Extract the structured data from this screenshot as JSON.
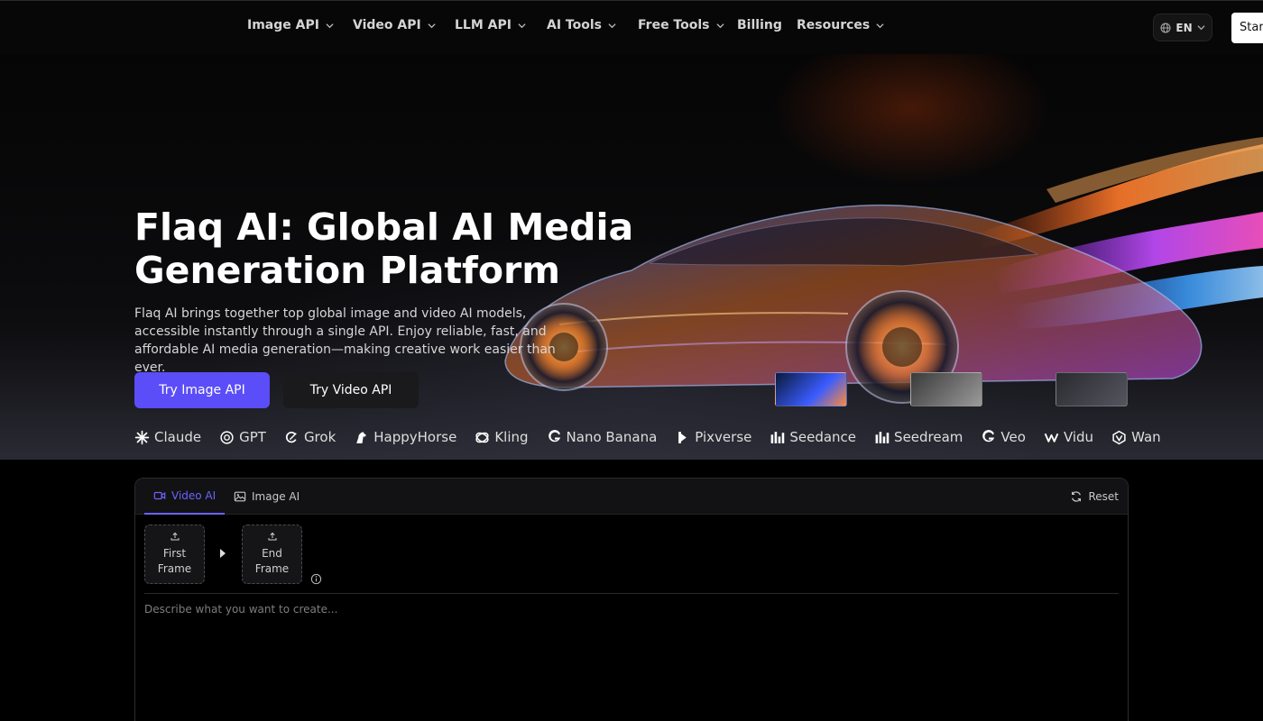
{
  "nav": {
    "items": [
      {
        "label": "Image API",
        "dropdown": true
      },
      {
        "label": "Video API",
        "dropdown": true
      },
      {
        "label": "LLM API",
        "dropdown": true
      },
      {
        "label": "AI Tools",
        "dropdown": true
      },
      {
        "label": "Free Tools",
        "dropdown": true
      },
      {
        "label": "Billing",
        "dropdown": false
      },
      {
        "label": "Resources",
        "dropdown": true
      }
    ],
    "language": "EN",
    "start_label": "Star"
  },
  "hero": {
    "title": "Flaq AI: Global AI Media Generation Platform",
    "description": "Flaq AI brings together top global image and video AI models, accessible instantly through a single API. Enjoy reliable, fast, and affordable AI media generation—making creative work easier than ever.",
    "primary_button": "Try Image API",
    "secondary_button": "Try Video API",
    "models": [
      {
        "name": "Claude",
        "icon": "claude-icon"
      },
      {
        "name": "GPT",
        "icon": "openai-icon"
      },
      {
        "name": "Grok",
        "icon": "grok-icon"
      },
      {
        "name": "HappyHorse",
        "icon": "horse-icon"
      },
      {
        "name": "Kling",
        "icon": "kling-icon"
      },
      {
        "name": "Nano Banana",
        "icon": "google-icon"
      },
      {
        "name": "Pixverse",
        "icon": "pixverse-icon"
      },
      {
        "name": "Seedance",
        "icon": "bars-icon"
      },
      {
        "name": "Seedream",
        "icon": "bars-icon"
      },
      {
        "name": "Veo",
        "icon": "google-icon"
      },
      {
        "name": "Vidu",
        "icon": "vidu-icon"
      },
      {
        "name": "Wan",
        "icon": "wan-icon"
      }
    ]
  },
  "workspace": {
    "tabs": [
      {
        "label": "Video AI",
        "icon": "video-camera-icon",
        "active": true
      },
      {
        "label": "Image AI",
        "icon": "image-icon",
        "active": false
      }
    ],
    "reset_label": "Reset",
    "first_frame_label": "First Frame",
    "end_frame_label": "End Frame",
    "prompt_placeholder": "Describe what you want to create..."
  },
  "colors": {
    "accent": "#5b4df7",
    "tab_active": "#6c63ff",
    "background": "#000000"
  }
}
